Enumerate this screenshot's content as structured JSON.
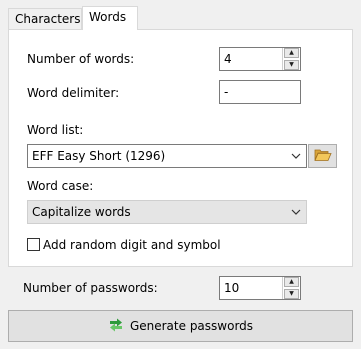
{
  "tabs": [
    {
      "label": "Characters",
      "active": false
    },
    {
      "label": "Words",
      "active": true
    }
  ],
  "words_panel": {
    "number_of_words_label": "Number of words:",
    "number_of_words_value": "4",
    "word_delimiter_label": "Word delimiter:",
    "word_delimiter_value": "-",
    "word_list_label": "Word list:",
    "word_list_selected": "EFF Easy Short (1296)",
    "word_case_label": "Word case:",
    "word_case_selected": "Capitalize words",
    "add_random_label": "Add random digit and symbol",
    "add_random_checked": false
  },
  "footer": {
    "number_of_passwords_label": "Number of passwords:",
    "number_of_passwords_value": "10",
    "generate_button_label": "Generate passwords"
  },
  "icons": {
    "browse": "folder-open-icon",
    "generate": "generate-arrows-icon"
  },
  "colors": {
    "panel_bg": "#ffffff",
    "window_bg": "#f0f0f0",
    "folder_icon": "#e8b84a",
    "generate_icon": "#2e9a3a"
  }
}
